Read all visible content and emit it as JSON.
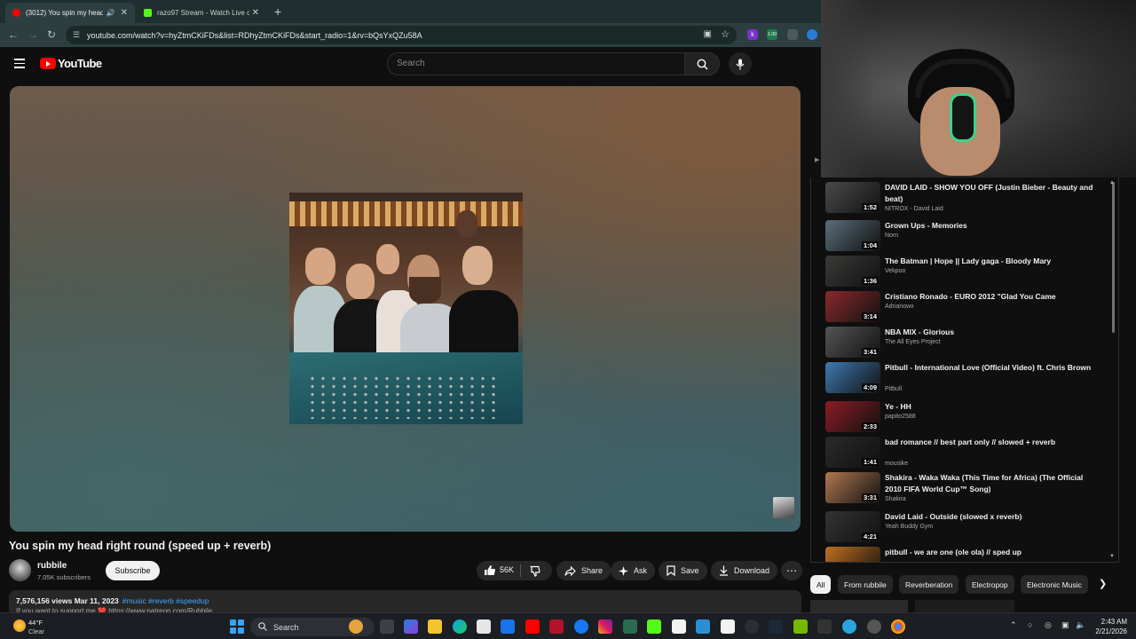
{
  "browser": {
    "tabs": [
      {
        "title": "(3012) You spin my head rig",
        "active": true
      },
      {
        "title": "razo97 Stream - Watch Live on",
        "active": false
      }
    ],
    "url": "youtube.com/watch?v=hyZtmCKiFDs&list=RDhyZtmCKiFDs&start_radio=1&rv=bQsYxQZu58A",
    "extensions": [
      "k",
      "1.00"
    ]
  },
  "youtube": {
    "logo_text": "YouTube",
    "search_placeholder": "Search"
  },
  "video": {
    "title": "You spin my head right round (speed up + reverb)",
    "channel": "rubbile",
    "subscribers": "7.05K subscribers",
    "subscribe_label": "Subscribe",
    "likes": "56K",
    "share_label": "Share",
    "ask_label": "Ask",
    "save_label": "Save",
    "download_label": "Download",
    "views_date": "7,576,156 views  Mar 11, 2023",
    "tags": "#music #reverb #speedup",
    "desc_line": "If you want to support me ❤️ https://www.patreon.com/Rubbile"
  },
  "playlist": [
    {
      "title": "DAVID LAID - SHOW YOU OFF (Justin Bieber - Beauty and beat)",
      "channel": "NITROX - David Laid",
      "duration": "1:52",
      "thumb_color": "#4a4a4a"
    },
    {
      "title": "Grown Ups - Memories",
      "channel": "Norn",
      "duration": "1:04",
      "thumb_color": "#5b6e7a"
    },
    {
      "title": "The Batman | Hope || Lady gaga - Bloody Mary",
      "channel": "Vekpoo",
      "duration": "1:36",
      "thumb_color": "#3a3a38"
    },
    {
      "title": "Cristiano Ronado - EURO 2012 \"Glad You Came",
      "channel": "Adrianowx",
      "duration": "3:14",
      "thumb_color": "#8a2a2a"
    },
    {
      "title": "NBA MIX - Glorious",
      "channel": "The All Eyes Project",
      "duration": "3:41",
      "thumb_color": "#555555"
    },
    {
      "title": "Pitbull - International Love (Official Video) ft. Chris Brown",
      "channel": "Pitbull",
      "duration": "4:09",
      "thumb_color": "#3e7ab0"
    },
    {
      "title": "Ye - HH",
      "channel": "papito2588",
      "duration": "2:33",
      "thumb_color": "#8c1c24"
    },
    {
      "title": "bad romance // best part only // slowed + reverb",
      "channel": "mousike",
      "duration": "1:41",
      "thumb_color": "#2a2a2a"
    },
    {
      "title": "Shakira - Waka Waka (This Time for Africa) (The Official 2010 FIFA World Cup™ Song)",
      "channel": "Shakira",
      "duration": "3:31",
      "thumb_color": "#b07850"
    },
    {
      "title": "David Laid - Outside (slowed x reverb)",
      "channel": "Yeah Buddy Gym",
      "duration": "4:21",
      "thumb_color": "#333333"
    },
    {
      "title": "pitbull - we are one (ole ola) // sped up",
      "channel": "",
      "duration": "",
      "thumb_color": "#c27020"
    }
  ],
  "chips": [
    "All",
    "From rubbile",
    "Reverberation",
    "Electropop",
    "Electronic Music"
  ],
  "taskbar": {
    "weather_temp": "44°F",
    "weather_cond": "Clear",
    "search_label": "Search",
    "time": "2:43 AM",
    "date": "2/21/2026"
  },
  "colors": {
    "accent_red": "#ff0000",
    "link_blue": "#3ea6ff",
    "bg": "#0f0f0f"
  }
}
